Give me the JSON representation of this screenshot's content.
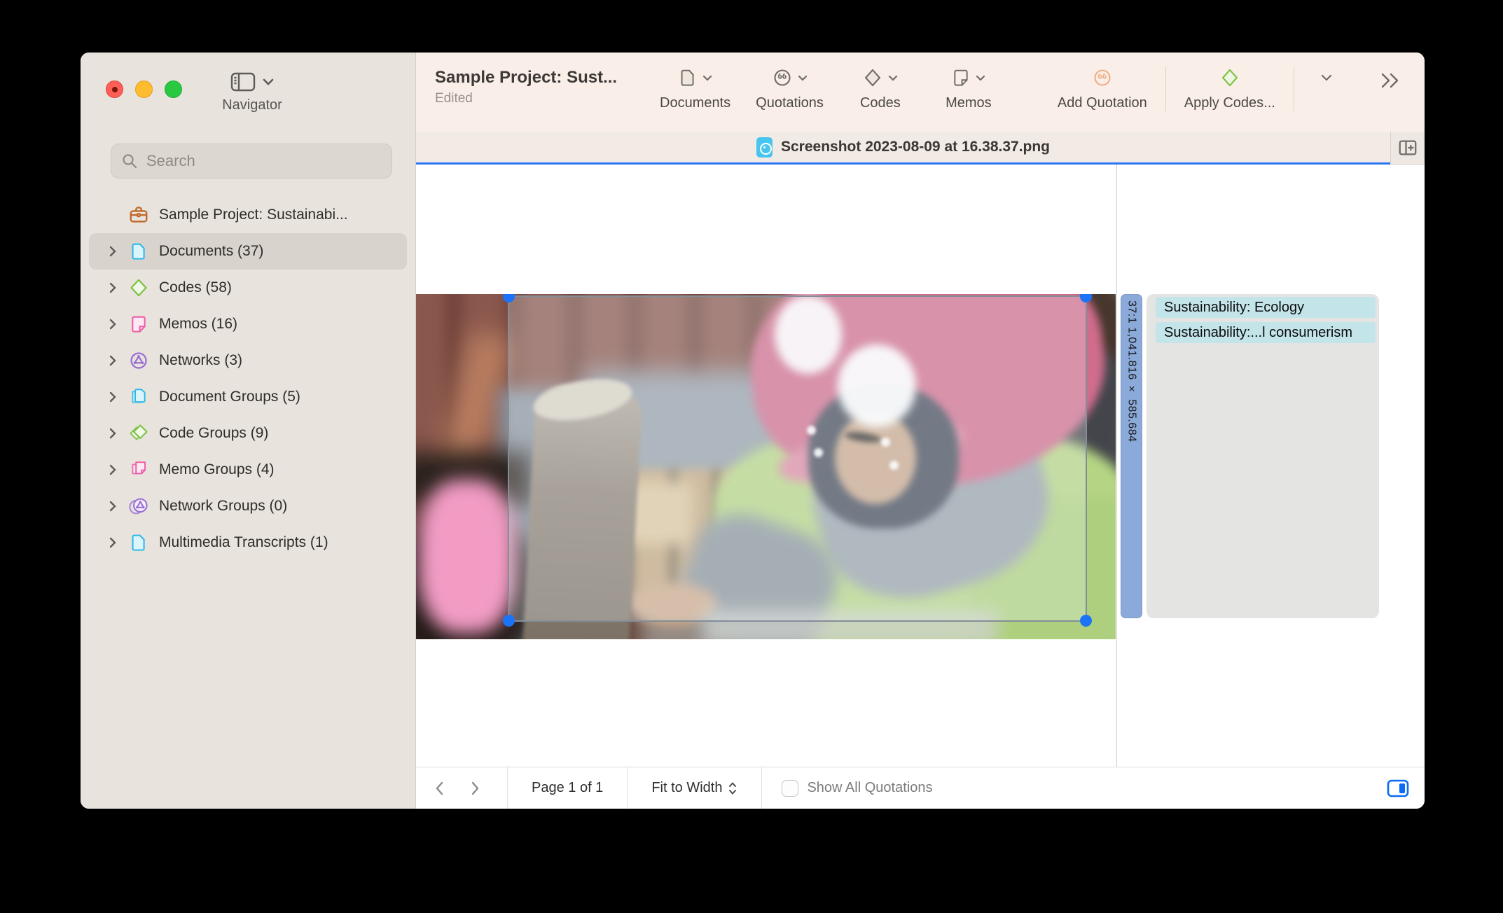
{
  "window": {
    "navigator_label": "Navigator"
  },
  "sidebar": {
    "search_placeholder": "Search",
    "items": [
      {
        "label": "Sample Project: Sustainabi...",
        "icon": "briefcase-icon",
        "selected": false
      },
      {
        "label": "Documents (37)",
        "icon": "document-icon",
        "selected": true
      },
      {
        "label": "Codes (58)",
        "icon": "code-diamond-icon",
        "selected": false
      },
      {
        "label": "Memos (16)",
        "icon": "memo-icon",
        "selected": false
      },
      {
        "label": "Networks (3)",
        "icon": "network-icon",
        "selected": false
      },
      {
        "label": "Document Groups (5)",
        "icon": "document-group-icon",
        "selected": false
      },
      {
        "label": "Code Groups (9)",
        "icon": "code-group-icon",
        "selected": false
      },
      {
        "label": "Memo Groups (4)",
        "icon": "memo-group-icon",
        "selected": false
      },
      {
        "label": "Network Groups (0)",
        "icon": "network-group-icon",
        "selected": false
      },
      {
        "label": "Multimedia Transcripts (1)",
        "icon": "document-icon",
        "selected": false
      }
    ]
  },
  "header": {
    "title": "Sample Project: Sust...",
    "subtitle": "Edited",
    "toolbar": [
      {
        "label": "Documents",
        "icon": "document-icon",
        "has_chevron": true
      },
      {
        "label": "Quotations",
        "icon": "quotation-icon",
        "has_chevron": true
      },
      {
        "label": "Codes",
        "icon": "code-diamond-icon",
        "has_chevron": true
      },
      {
        "label": "Memos",
        "icon": "memo-icon",
        "has_chevron": true
      },
      {
        "label": "Add Quotation",
        "icon": "add-quotation-icon",
        "has_chevron": false
      },
      {
        "label": "Apply Codes...",
        "icon": "apply-codes-diamond-icon",
        "has_chevron": false
      }
    ]
  },
  "tab": {
    "title": "Screenshot 2023-08-09 at 16.38.37.png"
  },
  "document_view": {
    "quotation_bar_label": "37:1 1,041.816 × 585.684",
    "codes": [
      "Sustainability: Ecology",
      "Sustainability:...l consumerism"
    ]
  },
  "bottom_bar": {
    "page_label": "Page 1 of 1",
    "zoom_label": "Fit to Width",
    "show_all_quotations_label": "Show All Quotations"
  },
  "colors": {
    "selection_handle_blue": "#1b74f7",
    "active_tab_underline": "#2a76f3",
    "quotation_bar_blue": "#8caad9",
    "code_chip_teal": "#c3e4e8",
    "code_chip_accent": "#9fcdd3",
    "sidebar_bg": "#e8e3dd",
    "header_bg": "#f9efe8",
    "panel_toggle_blue": "#0a6cf5"
  }
}
